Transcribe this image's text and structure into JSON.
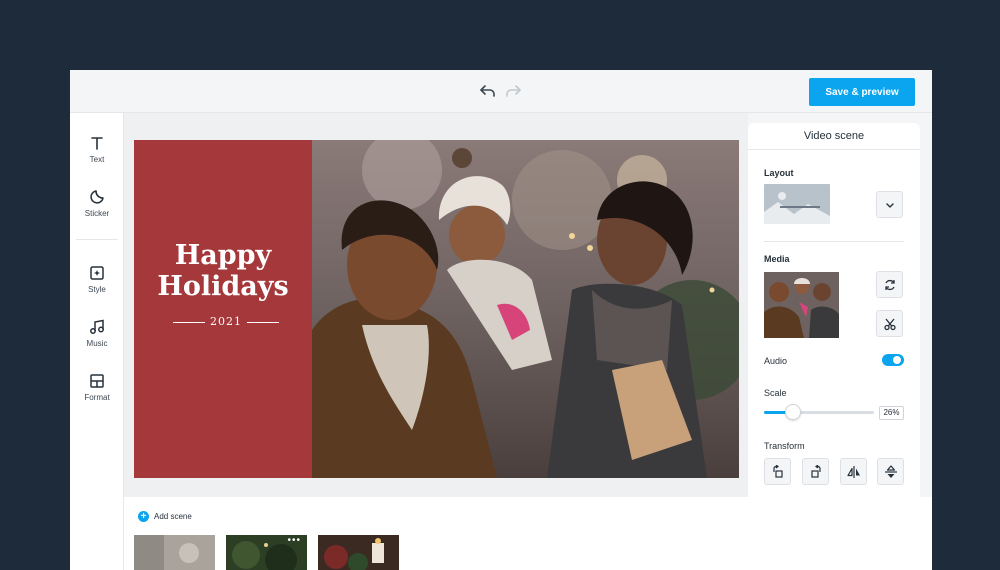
{
  "toolbar": {
    "undo_icon": "undo-arrow-icon",
    "redo_icon": "redo-arrow-icon",
    "save_label": "Save & preview"
  },
  "sidebar": {
    "items": [
      {
        "label": "Text",
        "icon": "text-icon"
      },
      {
        "label": "Sticker",
        "icon": "sticker-icon"
      },
      {
        "label": "Style",
        "icon": "style-icon"
      },
      {
        "label": "Music",
        "icon": "music-note-icon"
      },
      {
        "label": "Format",
        "icon": "format-icon"
      }
    ]
  },
  "card": {
    "line1": "Happy",
    "line2": "Holidays",
    "year": "2021",
    "panel_color": "#a5383b"
  },
  "panel": {
    "title": "Video scene",
    "layout_label": "Layout",
    "media_label": "Media",
    "audio_label": "Audio",
    "audio_on": true,
    "scale_label": "Scale",
    "scale_value": "26%",
    "scale_fraction": 0.26,
    "transform_label": "Transform",
    "transform_icons": [
      "rotate-left-icon",
      "rotate-right-icon",
      "flip-horizontal-icon",
      "flip-vertical-icon"
    ]
  },
  "scenes": {
    "add_label": "Add scene",
    "more_label": "•••",
    "thumbs": 3
  },
  "colors": {
    "accent": "#0aa5ee",
    "frame": "#1d2b3a"
  }
}
